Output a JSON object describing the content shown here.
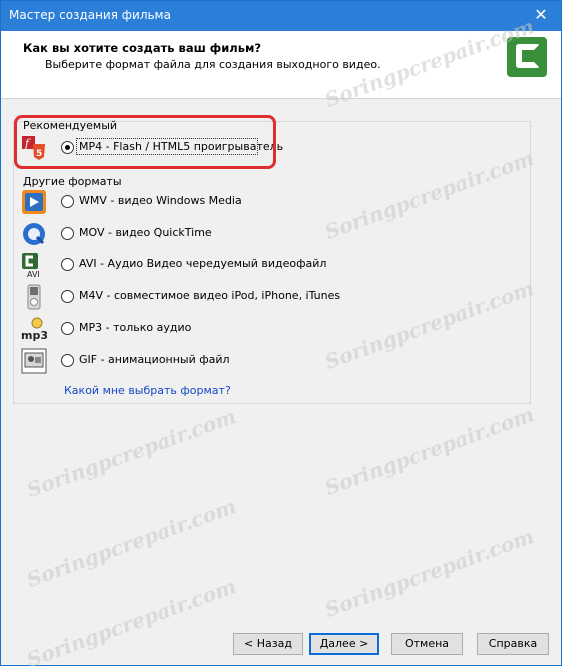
{
  "window": {
    "title": "Мастер создания фильма",
    "close_symbol": "✕"
  },
  "header": {
    "title": "Как вы хотите создать ваш фильм?",
    "subtitle": "Выберите формат файла для создания выходного видео."
  },
  "recommended": {
    "label": "Рекомендуемый",
    "option": {
      "label": "MP4 - Flash / HTML5 проигрыватель",
      "checked": true,
      "icon": "flash-html5-icon"
    }
  },
  "other": {
    "label": "Другие форматы",
    "options": [
      {
        "label": "WMV - видео Windows Media",
        "icon": "windows-media-icon"
      },
      {
        "label": "MOV - видео QuickTime",
        "icon": "quicktime-icon"
      },
      {
        "label": "AVI - Аудио Видео чередуемый видеофайл",
        "icon": "avi-icon"
      },
      {
        "label": "M4V - совместимое видео iPod, iPhone, iTunes",
        "icon": "ipod-icon"
      },
      {
        "label": "MP3 - только аудио",
        "icon": "mp3-icon"
      },
      {
        "label": "GIF - анимационный файл",
        "icon": "gif-icon"
      }
    ]
  },
  "help_link": "Какой мне выбрать формат?",
  "buttons": {
    "back": "< Назад",
    "next": "Далее >",
    "cancel": "Отмена",
    "help": "Справка"
  },
  "watermark": "Soringpcrepair.com",
  "colors": {
    "accent": "#2b7fd8",
    "highlight": "#e02d2d",
    "link": "#1448c8"
  }
}
